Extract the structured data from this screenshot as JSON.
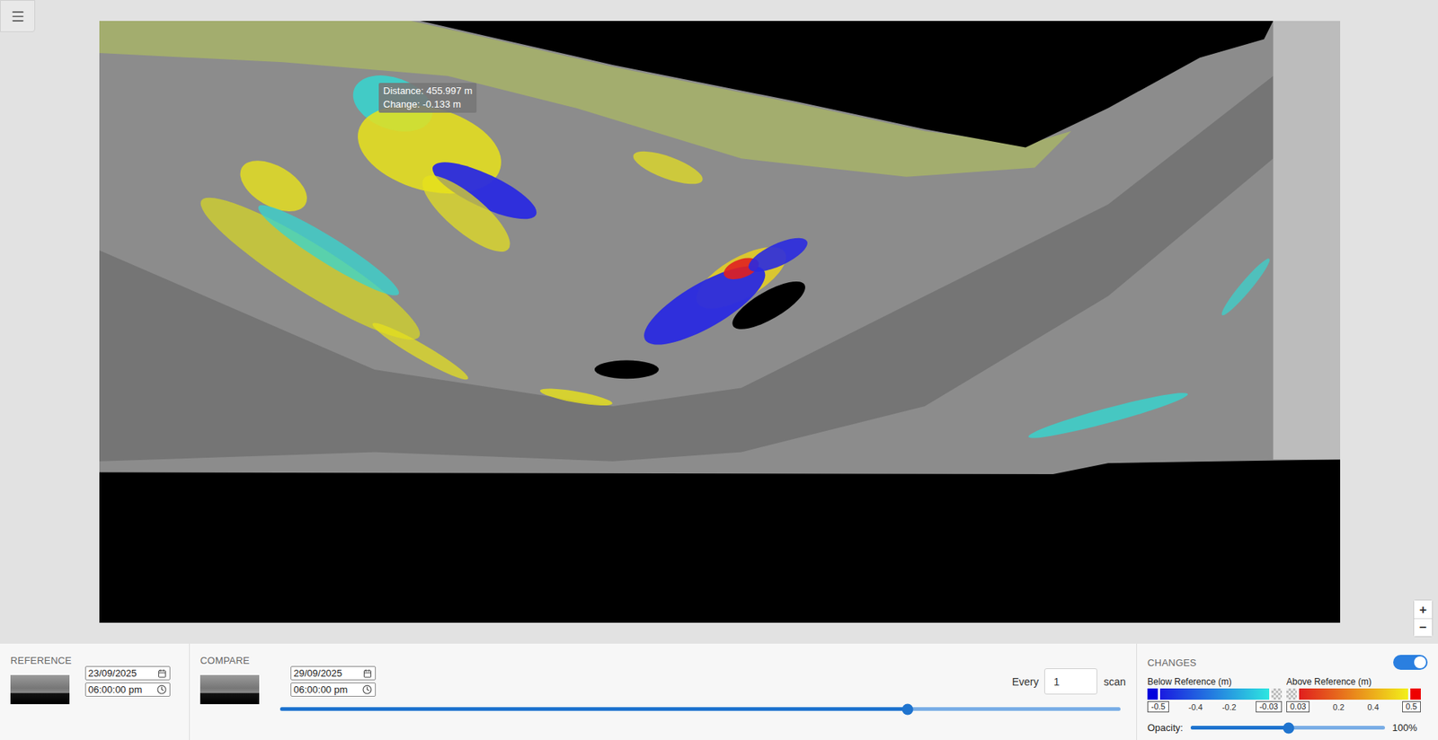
{
  "viewer": {
    "tooltip": {
      "distance": "Distance: 455.997 m",
      "change": "Change: -0.133 m"
    }
  },
  "zoom": {
    "buttons": [
      "+",
      "−"
    ]
  },
  "reference": {
    "label": "REFERENCE",
    "date": "23/09/2025",
    "time": "06:00:00 pm"
  },
  "compare": {
    "label": "COMPARE",
    "date": "29/09/2025",
    "time": "06:00:00 pm",
    "every_label": "Every",
    "every_value": "1",
    "every_unit": "scan",
    "slider": {
      "level": 0.747
    }
  },
  "changes": {
    "label": "CHANGES",
    "toggle": {
      "on": true
    },
    "below": {
      "title": "Below Reference (m)",
      "min": "-0.5",
      "ticks": [
        "-0.4",
        "-0.2"
      ],
      "max": "-0.03",
      "gradient": [
        "#1a1ae0",
        "#2ee6e0"
      ],
      "end_color": "#0000dd",
      "end_side": "left"
    },
    "above": {
      "title": "Above Reference (m)",
      "min": "0.03",
      "ticks": [
        "0.2",
        "0.4"
      ],
      "max": "0.5",
      "gradient": [
        "#f2f01a",
        "#e01e1e"
      ],
      "end_color": "#ee0000",
      "end_side": "right"
    },
    "opacity": {
      "label": "Opacity:",
      "level": 0.505,
      "reading": "100%"
    }
  }
}
